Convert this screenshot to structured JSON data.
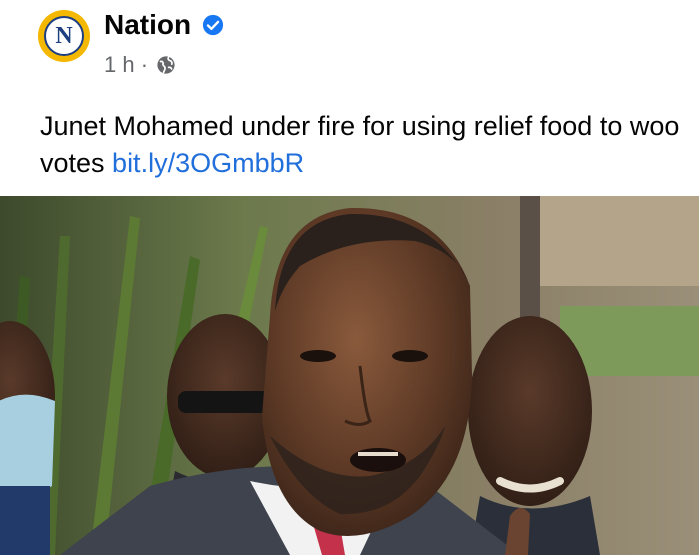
{
  "post": {
    "page_name": "Nation",
    "avatar_letter": "N",
    "time": "1 h",
    "separator": "·",
    "privacy_icon": "globe-icon",
    "verified_icon": "verified-badge-icon",
    "text_before_link": "Junet Mohamed under fire for using relief food to woo votes ",
    "link_text": "bit.ly/3OGmbbR"
  },
  "colors": {
    "avatar_ring": "#f5b800",
    "avatar_letter": "#1d3e80",
    "verified": "#1877f2",
    "link": "#216fdb",
    "meta": "#65676b"
  }
}
